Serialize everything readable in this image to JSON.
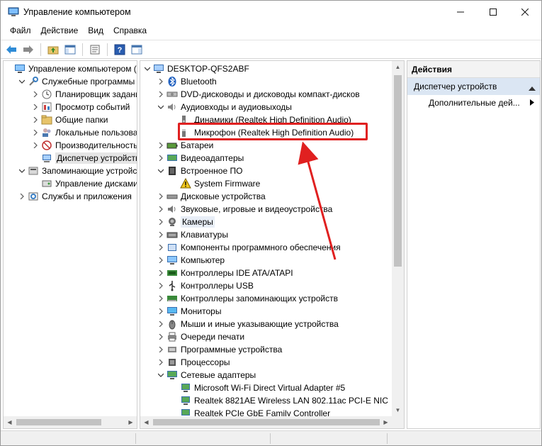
{
  "window": {
    "title": "Управление компьютером"
  },
  "menu": [
    "Файл",
    "Действие",
    "Вид",
    "Справка"
  ],
  "left_tree": {
    "items": [
      {
        "label": "Управление компьютером (л",
        "icon": "computer-management-icon",
        "level": 0,
        "expand": ""
      },
      {
        "label": "Служебные программы",
        "icon": "tools-icon",
        "level": 1,
        "expand": "collapse"
      },
      {
        "label": "Планировщик заданий",
        "icon": "clock-icon",
        "level": 2,
        "expand": "expand"
      },
      {
        "label": "Просмотр событий",
        "icon": "event-viewer-icon",
        "level": 2,
        "expand": "expand"
      },
      {
        "label": "Общие папки",
        "icon": "shared-folder-icon",
        "level": 2,
        "expand": "expand"
      },
      {
        "label": "Локальные пользовате",
        "icon": "users-icon",
        "level": 2,
        "expand": "expand"
      },
      {
        "label": "Производительность",
        "icon": "performance-icon",
        "level": 2,
        "expand": "expand"
      },
      {
        "label": "Диспетчер устройств",
        "icon": "device-manager-icon",
        "level": 2,
        "expand": "",
        "selected": true
      },
      {
        "label": "Запоминающие устройст",
        "icon": "storage-icon",
        "level": 1,
        "expand": "collapse"
      },
      {
        "label": "Управление дисками",
        "icon": "disk-management-icon",
        "level": 2,
        "expand": ""
      },
      {
        "label": "Службы и приложения",
        "icon": "services-icon",
        "level": 1,
        "expand": "expand"
      }
    ]
  },
  "device_tree": {
    "root": "DESKTOP-QFS2ABF",
    "items": [
      {
        "label": "Bluetooth",
        "icon": "bluetooth-icon",
        "level": 1,
        "expand": "expand"
      },
      {
        "label": "DVD-дисководы и дисководы компакт-дисков",
        "icon": "dvd-drive-icon",
        "level": 1,
        "expand": "expand"
      },
      {
        "label": "Аудиовходы и аудиовыходы",
        "icon": "speaker-icon",
        "level": 1,
        "expand": "collapse"
      },
      {
        "label": "Динамики (Realtek High Definition Audio)",
        "icon": "speakers-device-icon",
        "level": 2,
        "expand": ""
      },
      {
        "label": "Микрофон (Realtek High Definition Audio)",
        "icon": "microphone-device-icon",
        "level": 2,
        "expand": "",
        "highlighted": true
      },
      {
        "label": "Батареи",
        "icon": "battery-icon",
        "level": 1,
        "expand": "expand"
      },
      {
        "label": "Видеоадаптеры",
        "icon": "display-adapter-icon",
        "level": 1,
        "expand": "expand"
      },
      {
        "label": "Встроенное ПО",
        "icon": "firmware-icon",
        "level": 1,
        "expand": "collapse"
      },
      {
        "label": "System Firmware",
        "icon": "warning-icon",
        "level": 2,
        "expand": ""
      },
      {
        "label": "Дисковые устройства",
        "icon": "disk-drive-icon",
        "level": 1,
        "expand": "expand"
      },
      {
        "label": "Звуковые, игровые и видеоустройства",
        "icon": "sound-icon",
        "level": 1,
        "expand": "expand"
      },
      {
        "label": "Камеры",
        "icon": "camera-icon",
        "level": 1,
        "expand": "expand",
        "hover": true
      },
      {
        "label": "Клавиатуры",
        "icon": "keyboard-icon",
        "level": 1,
        "expand": "expand"
      },
      {
        "label": "Компоненты программного обеспечения",
        "icon": "software-component-icon",
        "level": 1,
        "expand": "expand"
      },
      {
        "label": "Компьютер",
        "icon": "computer-icon",
        "level": 1,
        "expand": "expand"
      },
      {
        "label": "Контроллеры IDE ATA/ATAPI",
        "icon": "ide-controller-icon",
        "level": 1,
        "expand": "expand"
      },
      {
        "label": "Контроллеры USB",
        "icon": "usb-icon",
        "level": 1,
        "expand": "expand"
      },
      {
        "label": "Контроллеры запоминающих устройств",
        "icon": "storage-controller-icon",
        "level": 1,
        "expand": "expand"
      },
      {
        "label": "Мониторы",
        "icon": "monitor-icon",
        "level": 1,
        "expand": "expand"
      },
      {
        "label": "Мыши и иные указывающие устройства",
        "icon": "mouse-icon",
        "level": 1,
        "expand": "expand"
      },
      {
        "label": "Очереди печати",
        "icon": "printer-icon",
        "level": 1,
        "expand": "expand"
      },
      {
        "label": "Программные устройства",
        "icon": "software-device-icon",
        "level": 1,
        "expand": "expand"
      },
      {
        "label": "Процессоры",
        "icon": "processor-icon",
        "level": 1,
        "expand": "expand"
      },
      {
        "label": "Сетевые адаптеры",
        "icon": "network-adapter-icon",
        "level": 1,
        "expand": "collapse"
      },
      {
        "label": "Microsoft Wi-Fi Direct Virtual Adapter #5",
        "icon": "network-card-icon",
        "level": 2,
        "expand": ""
      },
      {
        "label": "Realtek 8821AE Wireless LAN 802.11ac PCI-E NIC",
        "icon": "network-card-icon",
        "level": 2,
        "expand": ""
      },
      {
        "label": "Realtek PCIe GbE Family Controller",
        "icon": "network-card-icon",
        "level": 2,
        "expand": ""
      }
    ]
  },
  "actions": {
    "header": "Действия",
    "section": "Диспетчер устройств",
    "more": "Дополнительные дей..."
  },
  "colors": {
    "annotation": "#e02020",
    "selection": "#e5e5e5",
    "actions_section": "#dbe6f3"
  }
}
